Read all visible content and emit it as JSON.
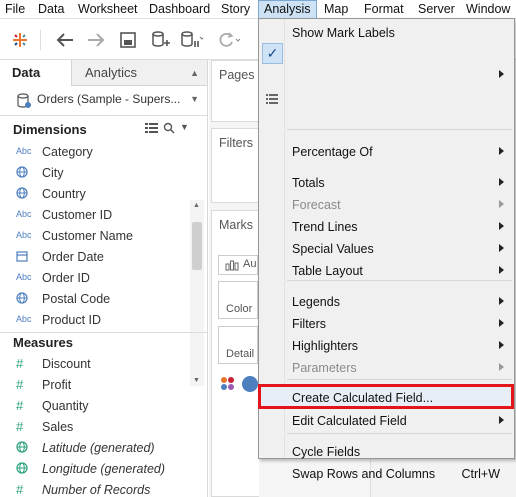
{
  "menubar": {
    "items": [
      "File",
      "Data",
      "Worksheet",
      "Dashboard",
      "Story",
      "Analysis",
      "Map",
      "Format",
      "Server",
      "Window"
    ],
    "active": "Analysis"
  },
  "data_pane": {
    "tabs": {
      "data": "Data",
      "analytics": "Analytics"
    },
    "datasource": "Orders (Sample - Supers...",
    "dimensions_title": "Dimensions",
    "dimensions": [
      {
        "type": "Abc",
        "name": "Category",
        "icon": "abc-icon"
      },
      {
        "type": "geo",
        "name": "City",
        "icon": "globe-icon"
      },
      {
        "type": "geo",
        "name": "Country",
        "icon": "globe-icon"
      },
      {
        "type": "Abc",
        "name": "Customer ID",
        "icon": "abc-icon"
      },
      {
        "type": "Abc",
        "name": "Customer Name",
        "icon": "abc-icon"
      },
      {
        "type": "date",
        "name": "Order Date",
        "icon": "calendar-icon"
      },
      {
        "type": "Abc",
        "name": "Order ID",
        "icon": "abc-icon"
      },
      {
        "type": "geo",
        "name": "Postal Code",
        "icon": "globe-icon"
      },
      {
        "type": "Abc",
        "name": "Product ID",
        "icon": "abc-icon"
      }
    ],
    "measures_title": "Measures",
    "measures": [
      {
        "type": "#",
        "name": "Discount",
        "icon": "number-icon"
      },
      {
        "type": "#",
        "name": "Profit",
        "icon": "number-icon"
      },
      {
        "type": "#",
        "name": "Quantity",
        "icon": "number-icon"
      },
      {
        "type": "#",
        "name": "Sales",
        "icon": "number-icon"
      },
      {
        "type": "geo",
        "name": "Latitude (generated)",
        "icon": "globe-icon"
      },
      {
        "type": "geo",
        "name": "Longitude (generated)",
        "icon": "globe-icon"
      },
      {
        "type": "#",
        "name": "Number of Records",
        "icon": "number-icon"
      }
    ]
  },
  "shelves": {
    "pages": "Pages",
    "filters": "Filters",
    "marks": "Marks",
    "marks_type": "Au",
    "color": "Color",
    "detail": "Detail"
  },
  "analysis_menu": {
    "items": [
      {
        "label": "Show Mark Labels",
        "checked": true
      },
      {
        "label": "",
        "submenu": true
      },
      {
        "label": "Percentage Of",
        "submenu": true
      },
      {
        "label": "Totals",
        "submenu": true
      },
      {
        "label": "Forecast",
        "submenu": true,
        "disabled": true
      },
      {
        "label": "Trend Lines",
        "submenu": true
      },
      {
        "label": "Special Values",
        "submenu": true
      },
      {
        "label": "Table Layout",
        "submenu": true
      },
      {
        "label": "Legends",
        "submenu": true
      },
      {
        "label": "Filters",
        "submenu": true
      },
      {
        "label": "Highlighters",
        "submenu": true
      },
      {
        "label": "Parameters",
        "submenu": true,
        "disabled": true
      },
      {
        "label": "Create Calculated Field...",
        "highlighted": true
      },
      {
        "label": "Edit Calculated Field",
        "submenu": true
      },
      {
        "label": "Cycle Fields"
      },
      {
        "label": "Swap Rows and Columns",
        "shortcut": "Ctrl+W"
      }
    ]
  },
  "colors": {
    "highlight_box": "#e3151a",
    "active_menu": "#cde3f5",
    "dimension_icon": "#4d7fbf",
    "measure_icon": "#2aa17c"
  }
}
